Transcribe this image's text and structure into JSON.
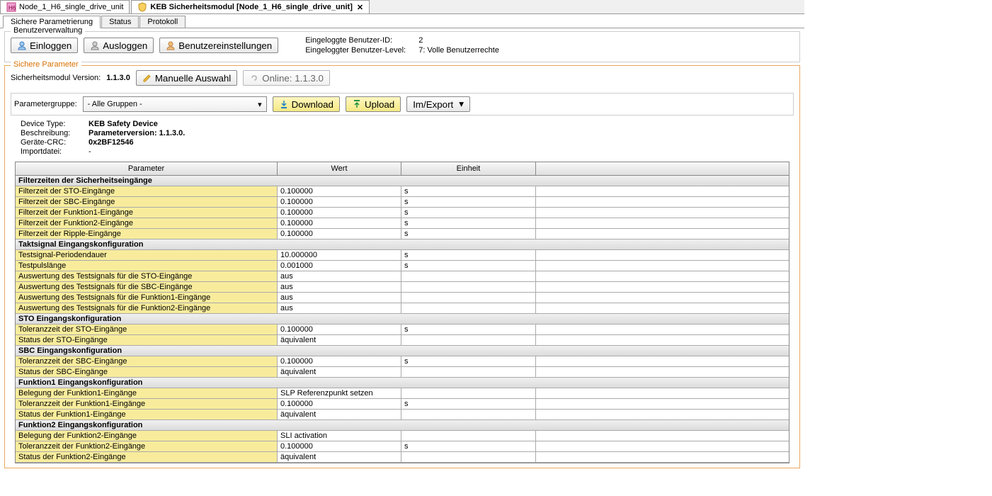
{
  "tabs": {
    "doc1": "Node_1_H6_single_drive_unit",
    "doc2": "KEB Sicherheitsmodul [Node_1_H6_single_drive_unit]"
  },
  "subtabs": {
    "t1": "Sichere Parametrierung",
    "t2": "Status",
    "t3": "Protokoll"
  },
  "userMgmt": {
    "title": "Benutzerverwaltung",
    "login": "Einloggen",
    "logout": "Ausloggen",
    "settings": "Benutzereinstellungen",
    "idLabel": "Eingeloggte Benutzer-ID:",
    "idValue": "2",
    "levelLabel": "Eingeloggter Benutzer-Level:",
    "levelValue": "7: Volle Benutzerrechte"
  },
  "safeParams": {
    "title": "Sichere Parameter",
    "versionLabel": "Sicherheitsmodul Version:",
    "versionValue": "1.1.3.0",
    "manual": "Manuelle Auswahl",
    "online": "Online: 1.1.3.0"
  },
  "paramGroup": {
    "label": "Parametergruppe:",
    "selected": "- Alle Gruppen -",
    "download": "Download",
    "upload": "Upload",
    "imexport": "Im/Export"
  },
  "device": {
    "typeLabel": "Device Type:",
    "typeValue": "KEB Safety Device",
    "descLabel": "Beschreibung:",
    "descValue": "Parameterversion: 1.1.3.0.",
    "crcLabel": "Geräte-CRC:",
    "crcValue": "0x2BF12546",
    "importLabel": "Importdatei:",
    "importValue": "-"
  },
  "tableHeaders": {
    "param": "Parameter",
    "wert": "Wert",
    "einheit": "Einheit"
  },
  "tableData": [
    {
      "type": "group",
      "label": "Filterzeiten der Sicherheitseingänge"
    },
    {
      "type": "row",
      "param": "Filterzeit der STO-Eingänge",
      "wert": "0.100000",
      "einheit": "s"
    },
    {
      "type": "row",
      "param": "Filterzeit der SBC-Eingänge",
      "wert": "0.100000",
      "einheit": "s"
    },
    {
      "type": "row",
      "param": "Filterzeit der Funktion1-Eingänge",
      "wert": "0.100000",
      "einheit": "s"
    },
    {
      "type": "row",
      "param": "Filterzeit der Funktion2-Eingänge",
      "wert": "0.100000",
      "einheit": "s"
    },
    {
      "type": "row",
      "param": "Filterzeit der Ripple-Eingänge",
      "wert": "0.100000",
      "einheit": "s"
    },
    {
      "type": "group",
      "label": "Taktsignal Eingangskonfiguration"
    },
    {
      "type": "row",
      "param": "Testsignal-Periodendauer",
      "wert": "10.000000",
      "einheit": "s"
    },
    {
      "type": "row",
      "param": "Testpulslänge",
      "wert": "0.001000",
      "einheit": "s"
    },
    {
      "type": "row",
      "param": "Auswertung des Testsignals für die STO-Eingänge",
      "wert": "aus",
      "einheit": ""
    },
    {
      "type": "row",
      "param": "Auswertung des Testsignals für die SBC-Eingänge",
      "wert": "aus",
      "einheit": ""
    },
    {
      "type": "row",
      "param": "Auswertung des Testsignals für die Funktion1-Eingänge",
      "wert": "aus",
      "einheit": ""
    },
    {
      "type": "row",
      "param": "Auswertung des Testsignals für die Funktion2-Eingänge",
      "wert": "aus",
      "einheit": ""
    },
    {
      "type": "group",
      "label": "STO Eingangskonfiguration"
    },
    {
      "type": "row",
      "param": "Toleranzzeit der STO-Eingänge",
      "wert": "0.100000",
      "einheit": "s"
    },
    {
      "type": "row",
      "param": "Status der STO-Eingänge",
      "wert": "äquivalent",
      "einheit": ""
    },
    {
      "type": "group",
      "label": "SBC Eingangskonfiguration"
    },
    {
      "type": "row",
      "param": "Toleranzzeit der SBC-Eingänge",
      "wert": "0.100000",
      "einheit": "s"
    },
    {
      "type": "row",
      "param": "Status der SBC-Eingänge",
      "wert": "äquivalent",
      "einheit": ""
    },
    {
      "type": "group",
      "label": "Funktion1 Eingangskonfiguration"
    },
    {
      "type": "row",
      "param": "Belegung der Funktion1-Eingänge",
      "wert": "SLP Referenzpunkt setzen",
      "einheit": ""
    },
    {
      "type": "row",
      "param": "Toleranzzeit der Funktion1-Eingänge",
      "wert": "0.100000",
      "einheit": "s"
    },
    {
      "type": "row",
      "param": "Status der Funktion1-Eingänge",
      "wert": "äquivalent",
      "einheit": ""
    },
    {
      "type": "group",
      "label": "Funktion2 Eingangskonfiguration"
    },
    {
      "type": "row",
      "param": "Belegung der Funktion2-Eingänge",
      "wert": "SLI activation",
      "einheit": ""
    },
    {
      "type": "row",
      "param": "Toleranzzeit der Funktion2-Eingänge",
      "wert": "0.100000",
      "einheit": "s"
    },
    {
      "type": "row",
      "param": "Status der Funktion2-Eingänge",
      "wert": "äquivalent",
      "einheit": ""
    }
  ]
}
